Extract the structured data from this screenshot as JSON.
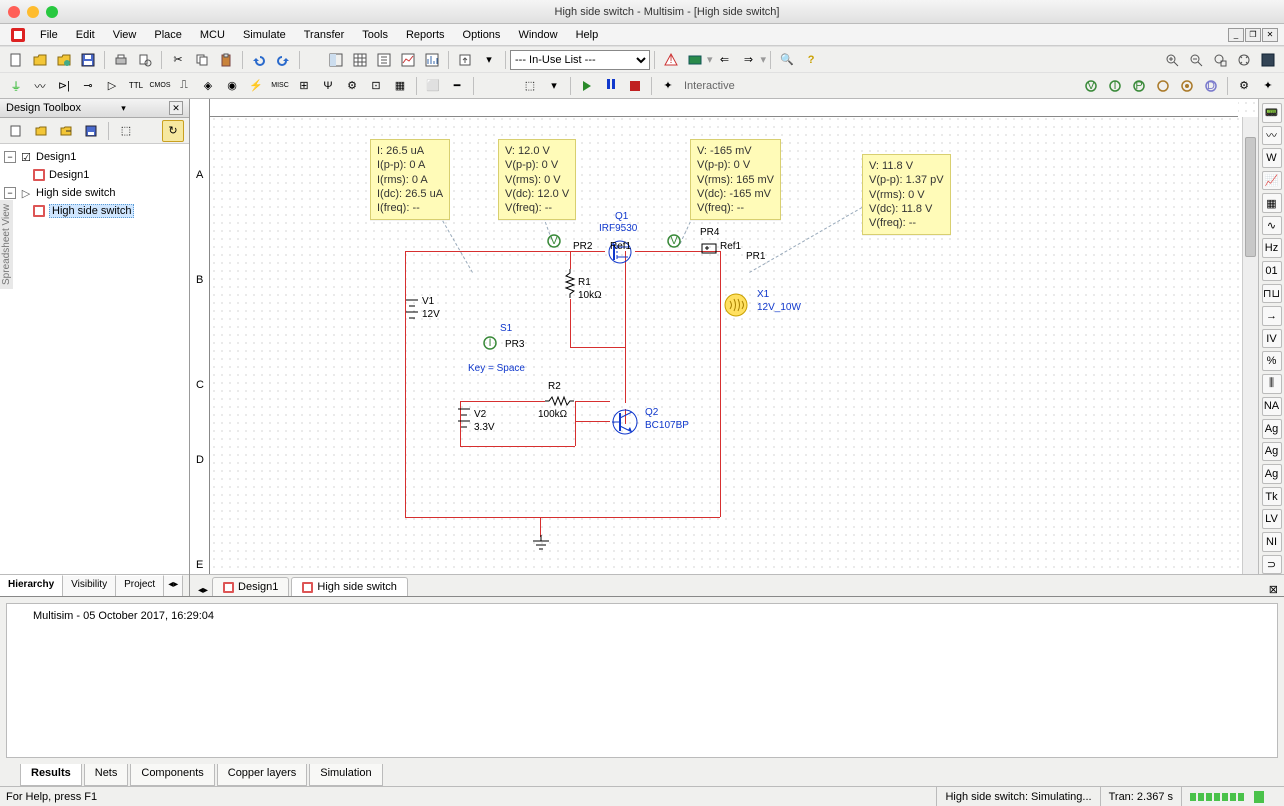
{
  "title": "High side switch - Multisim - [High side switch]",
  "menus": [
    "File",
    "Edit",
    "View",
    "Place",
    "MCU",
    "Simulate",
    "Transfer",
    "Tools",
    "Reports",
    "Options",
    "Window",
    "Help"
  ],
  "inuse_list": "--- In-Use List ---",
  "interactive_label": "Interactive",
  "design_toolbox": {
    "title": "Design Toolbox",
    "tree": {
      "root1": "Design1",
      "root1_child": "Design1",
      "root2": "High side switch",
      "root2_child": "High side switch"
    },
    "tabs": [
      "Hierarchy",
      "Visibility",
      "Project"
    ]
  },
  "doc_tabs": [
    "Design1",
    "High side switch"
  ],
  "probes": {
    "pr3": {
      "lines": [
        "I: 26.5 uA",
        "I(p-p): 0 A",
        "I(rms): 0 A",
        "I(dc): 26.5 uA",
        "I(freq): --"
      ]
    },
    "pr2": {
      "lines": [
        "V: 12.0 V",
        "V(p-p): 0 V",
        "V(rms): 0 V",
        "V(dc): 12.0 V",
        "V(freq): --"
      ]
    },
    "pr4": {
      "lines": [
        "V: -165 mV",
        "V(p-p): 0 V",
        "V(rms): 165 mV",
        "V(dc): -165 mV",
        "V(freq): --"
      ]
    },
    "pr1": {
      "lines": [
        "V: 11.8 V",
        "V(p-p): 1.37 pV",
        "V(rms): 0 V",
        "V(dc): 11.8 V",
        "V(freq): --"
      ]
    }
  },
  "components": {
    "v1": {
      "ref": "V1",
      "val": "12V"
    },
    "v2": {
      "ref": "V2",
      "val": "3.3V"
    },
    "r1": {
      "ref": "R1",
      "val": "10kΩ"
    },
    "r2": {
      "ref": "R2",
      "val": "100kΩ"
    },
    "s1": {
      "ref": "S1",
      "key": "Key = Space"
    },
    "q1": {
      "ref": "Q1",
      "val": "IRF9530"
    },
    "q2": {
      "ref": "Q2",
      "val": "BC107BP"
    },
    "x1": {
      "ref": "X1",
      "val": "12V_10W"
    },
    "pr1": "PR1",
    "pr2": "PR2",
    "pr3": "PR3",
    "pr4": "PR4",
    "ref1a": "Ref1",
    "ref1b": "Ref1"
  },
  "output": {
    "log_line": "Multisim  -  05 October 2017, 16:29:04",
    "tabs": [
      "Results",
      "Nets",
      "Components",
      "Copper layers",
      "Simulation"
    ]
  },
  "status": {
    "help": "For Help, press F1",
    "sim": "High side switch: Simulating...",
    "tran": "Tran: 2.367 s"
  }
}
